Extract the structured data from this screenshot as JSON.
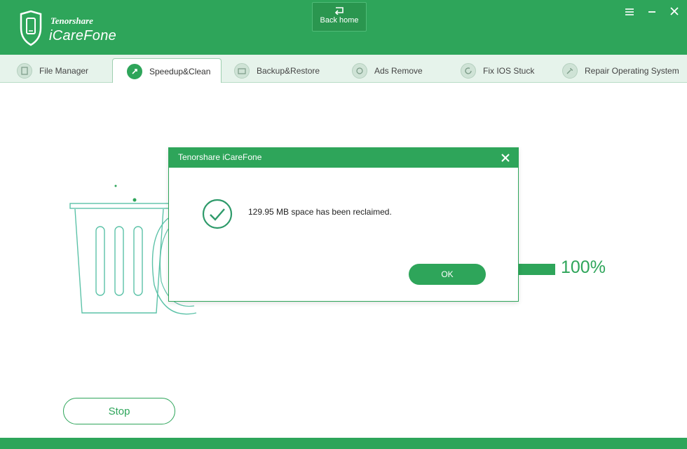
{
  "header": {
    "brand_company": "Tenorshare",
    "brand_product": "iCareFone",
    "back_home_label": "Back home"
  },
  "window_controls": {
    "icons": [
      "menu-icon",
      "minimize-icon",
      "close-icon"
    ]
  },
  "tabs": [
    {
      "label": "File Manager",
      "icon": "file-manager-icon",
      "active": false
    },
    {
      "label": "Speedup&Clean",
      "icon": "rocket-icon",
      "active": true
    },
    {
      "label": "Backup&Restore",
      "icon": "backup-icon",
      "active": false
    },
    {
      "label": "Ads Remove",
      "icon": "ads-remove-icon",
      "active": false
    },
    {
      "label": "Fix IOS Stuck",
      "icon": "refresh-icon",
      "active": false
    },
    {
      "label": "Repair Operating System",
      "icon": "wrench-icon",
      "active": false
    }
  ],
  "main": {
    "progress_percent_text": "100%",
    "progress_value": 1.0,
    "stop_label": "Stop"
  },
  "dialog": {
    "title": "Tenorshare iCareFone",
    "message": "129.95 MB space has been reclaimed.",
    "ok_label": "OK"
  },
  "colors": {
    "accent": "#2ea55a",
    "tab_bg": "#e6f3eb"
  }
}
